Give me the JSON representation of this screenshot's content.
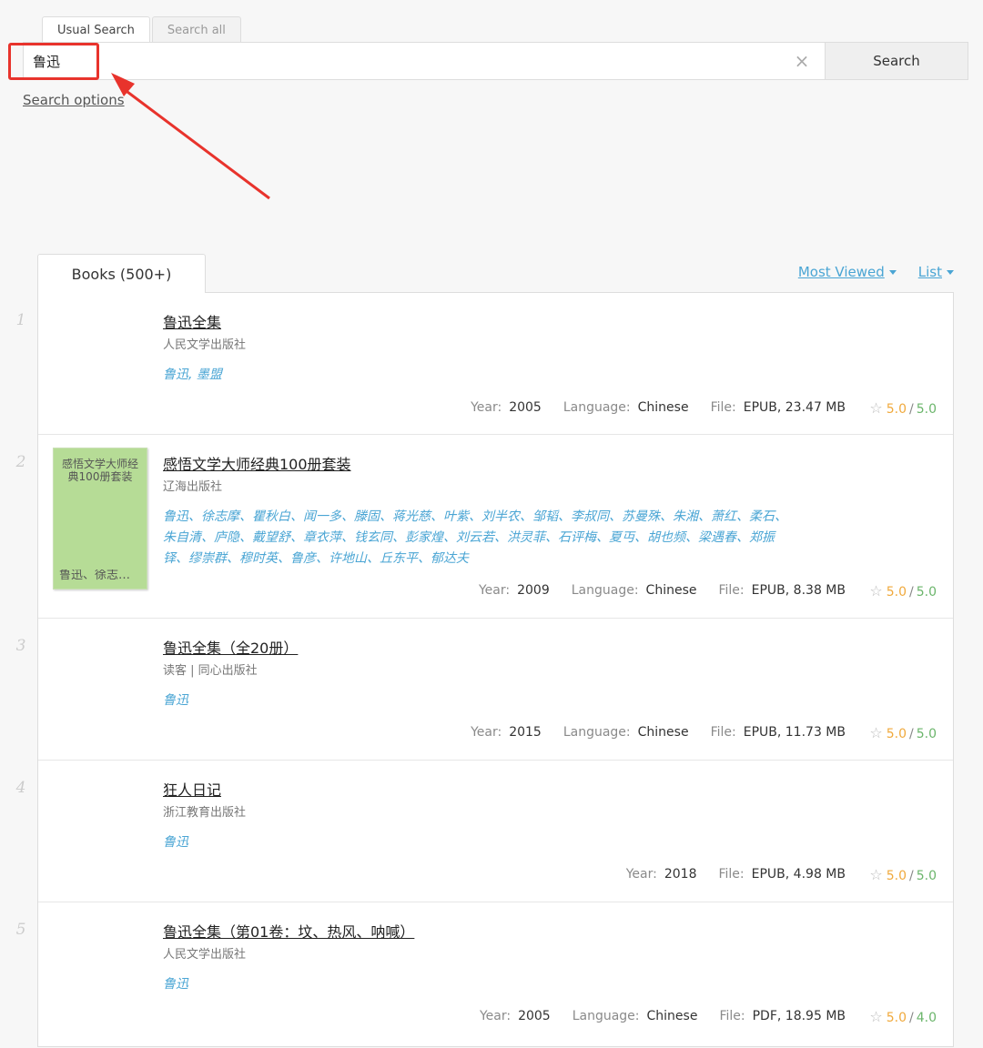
{
  "search": {
    "tabs": [
      "Usual Search",
      "Search all"
    ],
    "query": "鲁迅",
    "clear_icon": "×",
    "button_label": "Search",
    "options_label": "Search options"
  },
  "results": {
    "tab_label": "Books (500+)",
    "sort_label": "Most Viewed",
    "view_label": "List",
    "field_labels": {
      "year": "Year:",
      "language": "Language:",
      "file": "File:"
    },
    "items": [
      {
        "number": "1",
        "title": "鲁迅全集",
        "publisher": "人民文学出版社",
        "authors": [
          "鲁迅, 墨盟"
        ],
        "year": "2005",
        "language": "Chinese",
        "file": "EPUB, 23.47 MB",
        "rating_interest": "5.0",
        "rating_quality": "5.0"
      },
      {
        "number": "2",
        "title": "感悟文学大师经典100册套装",
        "publisher": "辽海出版社",
        "cover_text_top": "感悟文学大师经典100册套装",
        "cover_text_bottom": "鲁迅、徐志摩、瞿秋白、闻一...",
        "authors": [
          "鲁迅",
          "徐志摩",
          "瞿秋白",
          "闻一多",
          "滕固",
          "蒋光慈",
          "叶紫",
          "刘半农",
          "邹韬",
          "李叔同",
          "苏曼殊",
          "朱湘",
          "萧红",
          "柔石",
          "朱自清",
          "庐隐",
          "戴望舒",
          "章衣萍",
          "钱玄同",
          "彭家煌",
          "刘云若",
          "洪灵菲",
          "石评梅",
          "夏丏",
          "胡也频",
          "梁遇春",
          "郑振铎",
          "缪崇群",
          "穆时英",
          "鲁彦",
          "许地山",
          "丘东平",
          "郁达夫"
        ],
        "year": "2009",
        "language": "Chinese",
        "file": "EPUB, 8.38 MB",
        "rating_interest": "5.0",
        "rating_quality": "5.0"
      },
      {
        "number": "3",
        "title": "鲁迅全集（全20册）",
        "publisher": "读客 | 同心出版社",
        "authors": [
          "鲁迅"
        ],
        "year": "2015",
        "language": "Chinese",
        "file": "EPUB, 11.73 MB",
        "rating_interest": "5.0",
        "rating_quality": "5.0"
      },
      {
        "number": "4",
        "title": "狂人日记",
        "publisher": "浙江教育出版社",
        "authors": [
          "鲁迅"
        ],
        "year": "2018",
        "file": "EPUB, 4.98 MB",
        "rating_interest": "5.0",
        "rating_quality": "5.0"
      },
      {
        "number": "5",
        "title": "鲁迅全集（第01卷：坟、热风、呐喊）",
        "publisher": "人民文学出版社",
        "authors": [
          "鲁迅"
        ],
        "year": "2005",
        "language": "Chinese",
        "file": "PDF, 18.95 MB",
        "rating_interest": "5.0",
        "rating_quality": "4.0"
      }
    ]
  },
  "colors": {
    "link": "#4aa5d4",
    "rating_interest": "#f0a93c",
    "rating_quality": "#6bb56b",
    "annotation": "#e8332c",
    "cover": "#b6dc96"
  }
}
